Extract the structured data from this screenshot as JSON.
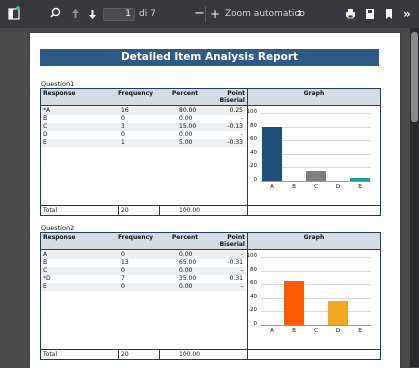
{
  "toolbar": {
    "page_current": "1",
    "page_total": "di 7",
    "zoom_label": "Zoom automatico",
    "zoom_arrow": "↕",
    "more": "»"
  },
  "report": {
    "title": "Detailed Item Analysis Report",
    "headers": {
      "response": "Response",
      "frequency": "Frequency",
      "percent": "Percent",
      "point_biserial_1": "Point",
      "point_biserial_2": "Biserial",
      "graph": "Graph"
    },
    "total_label": "Total",
    "questions": [
      {
        "label": "Question1",
        "rows": [
          {
            "response": "*A",
            "frequency": "16",
            "percent": "80.00",
            "pb": "0.25"
          },
          {
            "response": "B",
            "frequency": "0",
            "percent": "0.00",
            "pb": "-"
          },
          {
            "response": "C",
            "frequency": "3",
            "percent": "15.00",
            "pb": "-0.13"
          },
          {
            "response": "D",
            "frequency": "0",
            "percent": "0.00",
            "pb": "-"
          },
          {
            "response": "E",
            "frequency": "1",
            "percent": "5.00",
            "pb": "-0.33"
          }
        ],
        "total_frequency": "20",
        "total_percent": "100.00"
      },
      {
        "label": "Question2",
        "rows": [
          {
            "response": "A",
            "frequency": "0",
            "percent": "0.00",
            "pb": "-"
          },
          {
            "response": "B",
            "frequency": "13",
            "percent": "65.00",
            "pb": "-0.31"
          },
          {
            "response": "C",
            "frequency": "0",
            "percent": "0.00",
            "pb": "-"
          },
          {
            "response": "*D",
            "frequency": "7",
            "percent": "35.00",
            "pb": "0.31"
          },
          {
            "response": "E",
            "frequency": "0",
            "percent": "0.00",
            "pb": "-"
          }
        ],
        "total_frequency": "20",
        "total_percent": "100.00"
      }
    ]
  },
  "chart_data": [
    {
      "type": "bar",
      "categories": [
        "A",
        "B",
        "C",
        "D",
        "E"
      ],
      "values": [
        80,
        0,
        15,
        0,
        5
      ],
      "colors": [
        "#1f4e79",
        "#1f4e79",
        "#7f7f7f",
        "#7f7f7f",
        "#1a9e8f"
      ],
      "yticks": [
        "100",
        "80",
        "60",
        "40",
        "20",
        "0"
      ],
      "ylim": [
        0,
        100
      ]
    },
    {
      "type": "bar",
      "categories": [
        "A",
        "B",
        "C",
        "D",
        "E"
      ],
      "values": [
        0,
        65,
        0,
        35,
        0
      ],
      "colors": [
        "#ff5a00",
        "#ff5a00",
        "#ff5a00",
        "#f5a623",
        "#f5a623"
      ],
      "yticks": [
        "100",
        "80",
        "60",
        "40",
        "20",
        "0"
      ],
      "ylim": [
        0,
        100
      ]
    }
  ]
}
